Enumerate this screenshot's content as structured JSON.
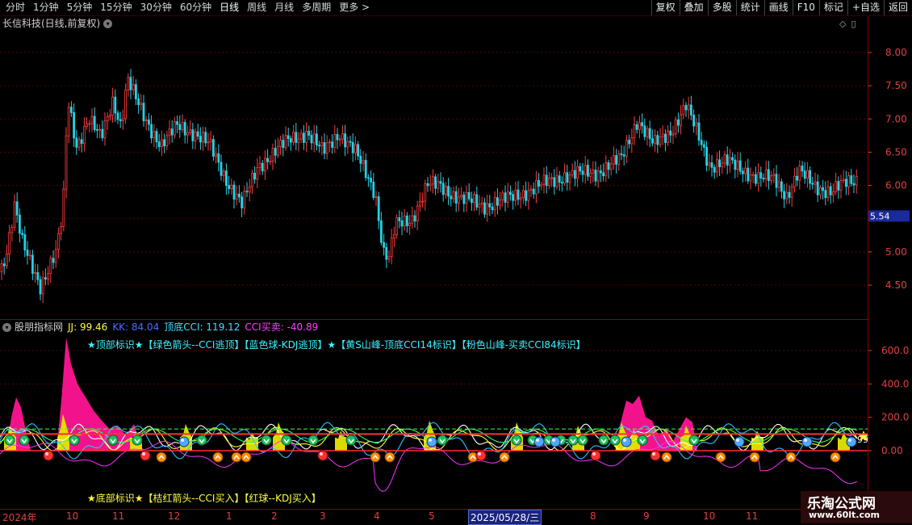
{
  "toolbar": {
    "periods": [
      "分时",
      "1分钟",
      "5分钟",
      "15分钟",
      "30分钟",
      "60分钟",
      "日线",
      "周线",
      "月线",
      "多周期",
      "更多"
    ],
    "more_arrow": ">",
    "buttons": [
      "复权",
      "叠加",
      "多股",
      "统计",
      "画线",
      "F10",
      "标记",
      "+自选",
      "返回"
    ]
  },
  "stock": {
    "title": "长信科技(日线,前复权)"
  },
  "price_axis": {
    "labels": [
      "8.00",
      "7.50",
      "7.00",
      "6.50",
      "6.00",
      "5.50",
      "5.00",
      "4.50"
    ],
    "current_price": "5.54"
  },
  "indicator": {
    "name": "股朋指标网",
    "jj_label": "JJ: 99.46",
    "kk_label": "KK: 84.04",
    "cci_label": "顶底CCI: 119.12",
    "cci_trade_label": "CCI买卖: -40.89",
    "top_legend": "★顶部标识★【绿色箭头--CCI逃顶】【蓝色球-KDJ逃顶】★【黄S山峰-顶底CCI14标识】【粉色山峰-买卖CCI84标识】",
    "bottom_legend": "★底部标识★【桔红箭头--CCI买入】【红球--KDJ买入】",
    "axis_labels": [
      "600.0",
      "400.0",
      "200.0",
      "0.00"
    ],
    "right_value": "99"
  },
  "date_axis": {
    "labels": [
      "2024年",
      "10",
      "11",
      "12",
      "1",
      "2",
      "3",
      "4",
      "5",
      "8",
      "9",
      "10",
      "11"
    ],
    "cursor_date": "2025/05/28/三"
  },
  "watermark": {
    "line1": "乐淘公式网",
    "line2": "www.60lt.com"
  },
  "colors": {
    "background": "#000000",
    "grid": "#5a0000",
    "up_candle": "#ff3b3b",
    "down_candle": "#22d3e6",
    "axis_text": "#e04040",
    "pink_mountain": "#ff1493",
    "yellow_mountain": "#e6e600",
    "green_arrow": "#20c060",
    "blue_ball": "#4fa8ff",
    "red_ball": "#ff3030",
    "orange_arrow": "#ff8c00",
    "cci_line": "#ff30ff"
  }
}
